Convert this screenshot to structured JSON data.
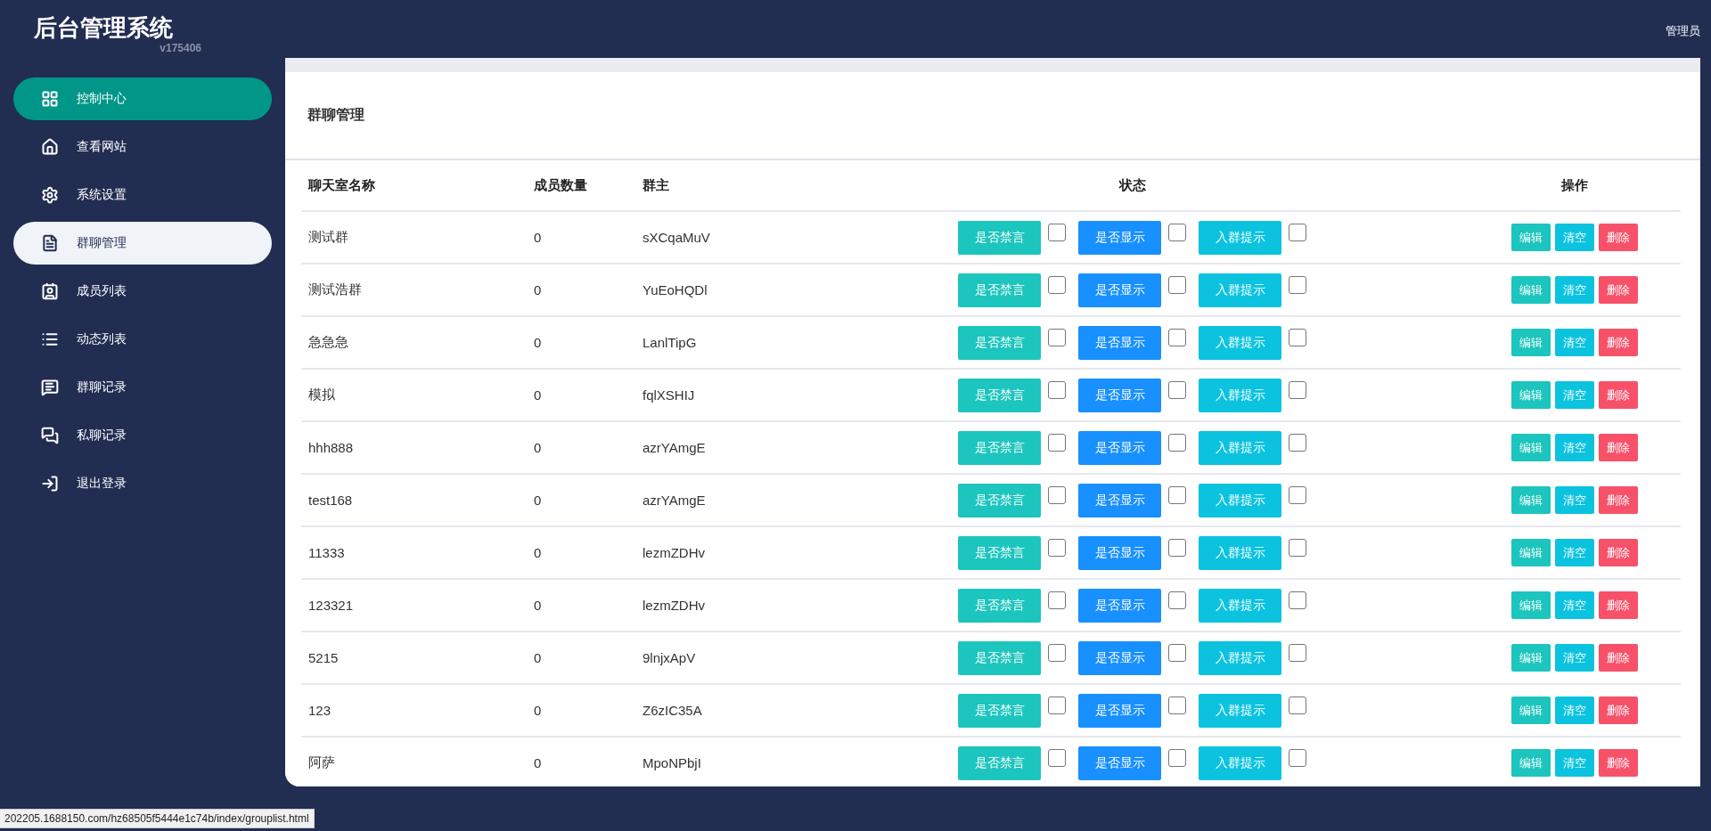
{
  "header": {
    "title": "后台管理系统",
    "version": "v175406",
    "user": "管理员"
  },
  "sidebar": {
    "items": [
      {
        "label": "控制中心",
        "kind": "grid",
        "highlighted": true,
        "selected": false
      },
      {
        "label": "查看网站",
        "kind": "home",
        "highlighted": false,
        "selected": false
      },
      {
        "label": "系统设置",
        "kind": "gear",
        "highlighted": false,
        "selected": false
      },
      {
        "label": "群聊管理",
        "kind": "doc",
        "highlighted": false,
        "selected": true
      },
      {
        "label": "成员列表",
        "kind": "contacts",
        "highlighted": false,
        "selected": false
      },
      {
        "label": "动态列表",
        "kind": "list",
        "highlighted": false,
        "selected": false
      },
      {
        "label": "群聊记录",
        "kind": "chat",
        "highlighted": false,
        "selected": false
      },
      {
        "label": "私聊记录",
        "kind": "chats",
        "highlighted": false,
        "selected": false
      },
      {
        "label": "退出登录",
        "kind": "logout",
        "highlighted": false,
        "selected": false
      }
    ]
  },
  "page_title": "群聊管理",
  "table": {
    "columns": [
      "聊天室名称",
      "成员数量",
      "群主",
      "状态",
      "操作"
    ],
    "rows": [
      {
        "name": "测试群",
        "members": "0",
        "owner": "sXCqaMuV",
        "toggles": [
          {
            "label": "是否禁言",
            "kind": "mute",
            "checked": false
          },
          {
            "label": "是否显示",
            "kind": "show",
            "checked": false
          },
          {
            "label": "入群提示",
            "kind": "notice",
            "checked": false
          }
        ],
        "actions": [
          {
            "label": "编辑",
            "kind": "edit"
          },
          {
            "label": "清空",
            "kind": "clear"
          },
          {
            "label": "删除",
            "kind": "delete"
          }
        ]
      },
      {
        "name": "测试浩群",
        "members": "0",
        "owner": "YuEoHQDl",
        "toggles": [
          {
            "label": "是否禁言",
            "kind": "mute",
            "checked": false
          },
          {
            "label": "是否显示",
            "kind": "show",
            "checked": false
          },
          {
            "label": "入群提示",
            "kind": "notice",
            "checked": false
          }
        ],
        "actions": [
          {
            "label": "编辑",
            "kind": "edit"
          },
          {
            "label": "清空",
            "kind": "clear"
          },
          {
            "label": "删除",
            "kind": "delete"
          }
        ]
      },
      {
        "name": "急急急",
        "members": "0",
        "owner": "LanlTipG",
        "toggles": [
          {
            "label": "是否禁言",
            "kind": "mute",
            "checked": false
          },
          {
            "label": "是否显示",
            "kind": "show",
            "checked": false
          },
          {
            "label": "入群提示",
            "kind": "notice",
            "checked": false
          }
        ],
        "actions": [
          {
            "label": "编辑",
            "kind": "edit"
          },
          {
            "label": "清空",
            "kind": "clear"
          },
          {
            "label": "删除",
            "kind": "delete"
          }
        ]
      },
      {
        "name": "模拟",
        "members": "0",
        "owner": "fqlXSHIJ",
        "toggles": [
          {
            "label": "是否禁言",
            "kind": "mute",
            "checked": false
          },
          {
            "label": "是否显示",
            "kind": "show",
            "checked": false
          },
          {
            "label": "入群提示",
            "kind": "notice",
            "checked": false
          }
        ],
        "actions": [
          {
            "label": "编辑",
            "kind": "edit"
          },
          {
            "label": "清空",
            "kind": "clear"
          },
          {
            "label": "删除",
            "kind": "delete"
          }
        ]
      },
      {
        "name": "hhh888",
        "members": "0",
        "owner": "azrYAmgE",
        "toggles": [
          {
            "label": "是否禁言",
            "kind": "mute",
            "checked": false
          },
          {
            "label": "是否显示",
            "kind": "show",
            "checked": false
          },
          {
            "label": "入群提示",
            "kind": "notice",
            "checked": false
          }
        ],
        "actions": [
          {
            "label": "编辑",
            "kind": "edit"
          },
          {
            "label": "清空",
            "kind": "clear"
          },
          {
            "label": "删除",
            "kind": "delete"
          }
        ]
      },
      {
        "name": "test168",
        "members": "0",
        "owner": "azrYAmgE",
        "toggles": [
          {
            "label": "是否禁言",
            "kind": "mute",
            "checked": false
          },
          {
            "label": "是否显示",
            "kind": "show",
            "checked": false
          },
          {
            "label": "入群提示",
            "kind": "notice",
            "checked": false
          }
        ],
        "actions": [
          {
            "label": "编辑",
            "kind": "edit"
          },
          {
            "label": "清空",
            "kind": "clear"
          },
          {
            "label": "删除",
            "kind": "delete"
          }
        ]
      },
      {
        "name": "11333",
        "members": "0",
        "owner": "lezmZDHv",
        "toggles": [
          {
            "label": "是否禁言",
            "kind": "mute",
            "checked": false
          },
          {
            "label": "是否显示",
            "kind": "show",
            "checked": false
          },
          {
            "label": "入群提示",
            "kind": "notice",
            "checked": false
          }
        ],
        "actions": [
          {
            "label": "编辑",
            "kind": "edit"
          },
          {
            "label": "清空",
            "kind": "clear"
          },
          {
            "label": "删除",
            "kind": "delete"
          }
        ]
      },
      {
        "name": "123321",
        "members": "0",
        "owner": "lezmZDHv",
        "toggles": [
          {
            "label": "是否禁言",
            "kind": "mute",
            "checked": false
          },
          {
            "label": "是否显示",
            "kind": "show",
            "checked": false
          },
          {
            "label": "入群提示",
            "kind": "notice",
            "checked": false
          }
        ],
        "actions": [
          {
            "label": "编辑",
            "kind": "edit"
          },
          {
            "label": "清空",
            "kind": "clear"
          },
          {
            "label": "删除",
            "kind": "delete"
          }
        ]
      },
      {
        "name": "5215",
        "members": "0",
        "owner": "9lnjxApV",
        "toggles": [
          {
            "label": "是否禁言",
            "kind": "mute",
            "checked": false
          },
          {
            "label": "是否显示",
            "kind": "show",
            "checked": false
          },
          {
            "label": "入群提示",
            "kind": "notice",
            "checked": false
          }
        ],
        "actions": [
          {
            "label": "编辑",
            "kind": "edit"
          },
          {
            "label": "清空",
            "kind": "clear"
          },
          {
            "label": "删除",
            "kind": "delete"
          }
        ]
      },
      {
        "name": "123",
        "members": "0",
        "owner": "Z6zIC35A",
        "toggles": [
          {
            "label": "是否禁言",
            "kind": "mute",
            "checked": false
          },
          {
            "label": "是否显示",
            "kind": "show",
            "checked": false
          },
          {
            "label": "入群提示",
            "kind": "notice",
            "checked": false
          }
        ],
        "actions": [
          {
            "label": "编辑",
            "kind": "edit"
          },
          {
            "label": "清空",
            "kind": "clear"
          },
          {
            "label": "删除",
            "kind": "delete"
          }
        ]
      },
      {
        "name": "阿萨",
        "members": "0",
        "owner": "MpoNPbjI",
        "toggles": [
          {
            "label": "是否禁言",
            "kind": "mute",
            "checked": false
          },
          {
            "label": "是否显示",
            "kind": "show",
            "checked": false
          },
          {
            "label": "入群提示",
            "kind": "notice",
            "checked": false
          }
        ],
        "actions": [
          {
            "label": "编辑",
            "kind": "edit"
          },
          {
            "label": "清空",
            "kind": "clear"
          },
          {
            "label": "删除",
            "kind": "delete"
          }
        ]
      }
    ]
  },
  "status_bar": "202205.1688150.com/hz68505f5444e1c74b/index/grouplist.html"
}
